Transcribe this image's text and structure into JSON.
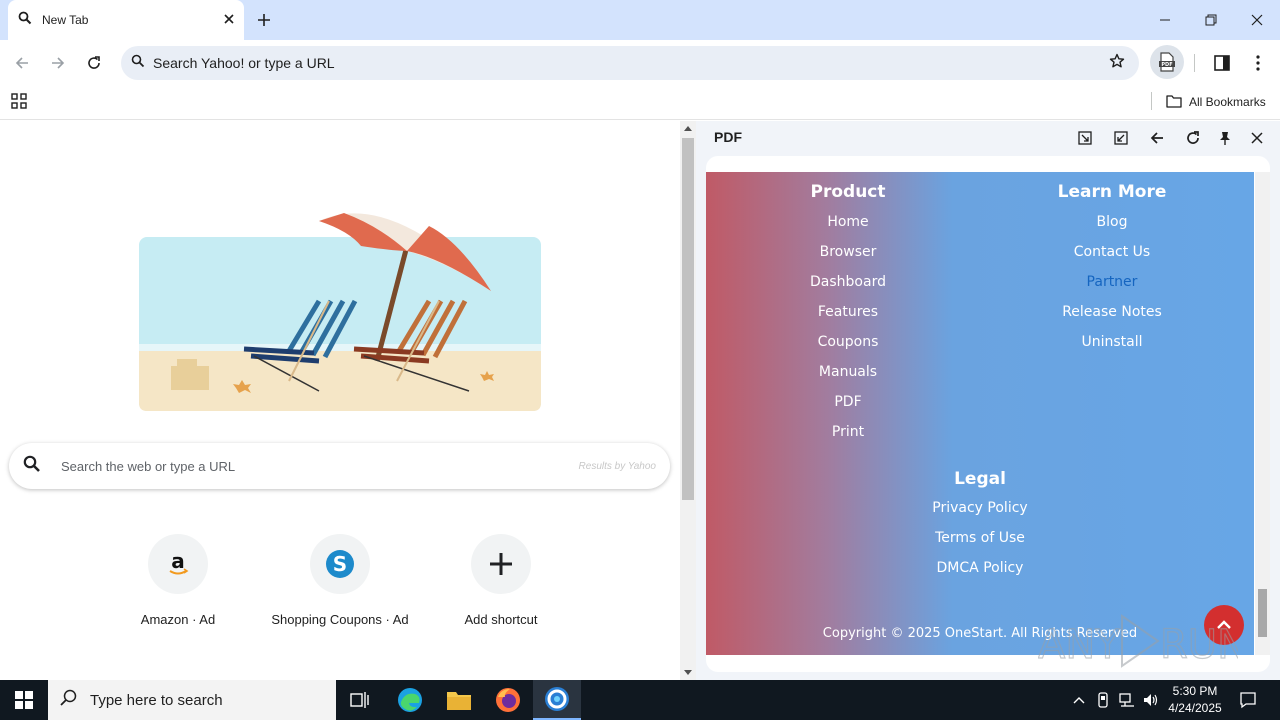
{
  "browser": {
    "tab_title": "New Tab",
    "omnibox_placeholder": "Search Yahoo! or type a URL",
    "all_bookmarks": "All Bookmarks"
  },
  "ntp": {
    "search_placeholder": "Search the web or type a URL",
    "results_by": "Results by Yahoo",
    "shortcuts": [
      {
        "label": "Amazon · Ad",
        "icon": "amazon-icon"
      },
      {
        "label": "Shopping Coupons · Ad",
        "icon": "shopping-coupons-icon"
      },
      {
        "label": "Add shortcut",
        "icon": "plus-icon"
      }
    ]
  },
  "side_panel": {
    "title": "PDF",
    "footer": {
      "product_heading": "Product",
      "product_items": [
        "Home",
        "Browser",
        "Dashboard",
        "Features",
        "Coupons",
        "Manuals",
        "PDF",
        "Print"
      ],
      "learn_heading": "Learn More",
      "learn_items": [
        "Blog",
        "Contact Us",
        "Partner",
        "Release Notes",
        "Uninstall"
      ],
      "legal_heading": "Legal",
      "legal_items": [
        "Privacy Policy",
        "Terms of Use",
        "DMCA Policy"
      ],
      "copyright": "Copyright © 2025 OneStart. All Rights Reserved",
      "highlight_color": "#1565c0"
    }
  },
  "taskbar": {
    "search_placeholder": "Type here to search",
    "time": "5:30 PM",
    "date": "4/24/2025"
  },
  "watermark": "ANY RUN"
}
